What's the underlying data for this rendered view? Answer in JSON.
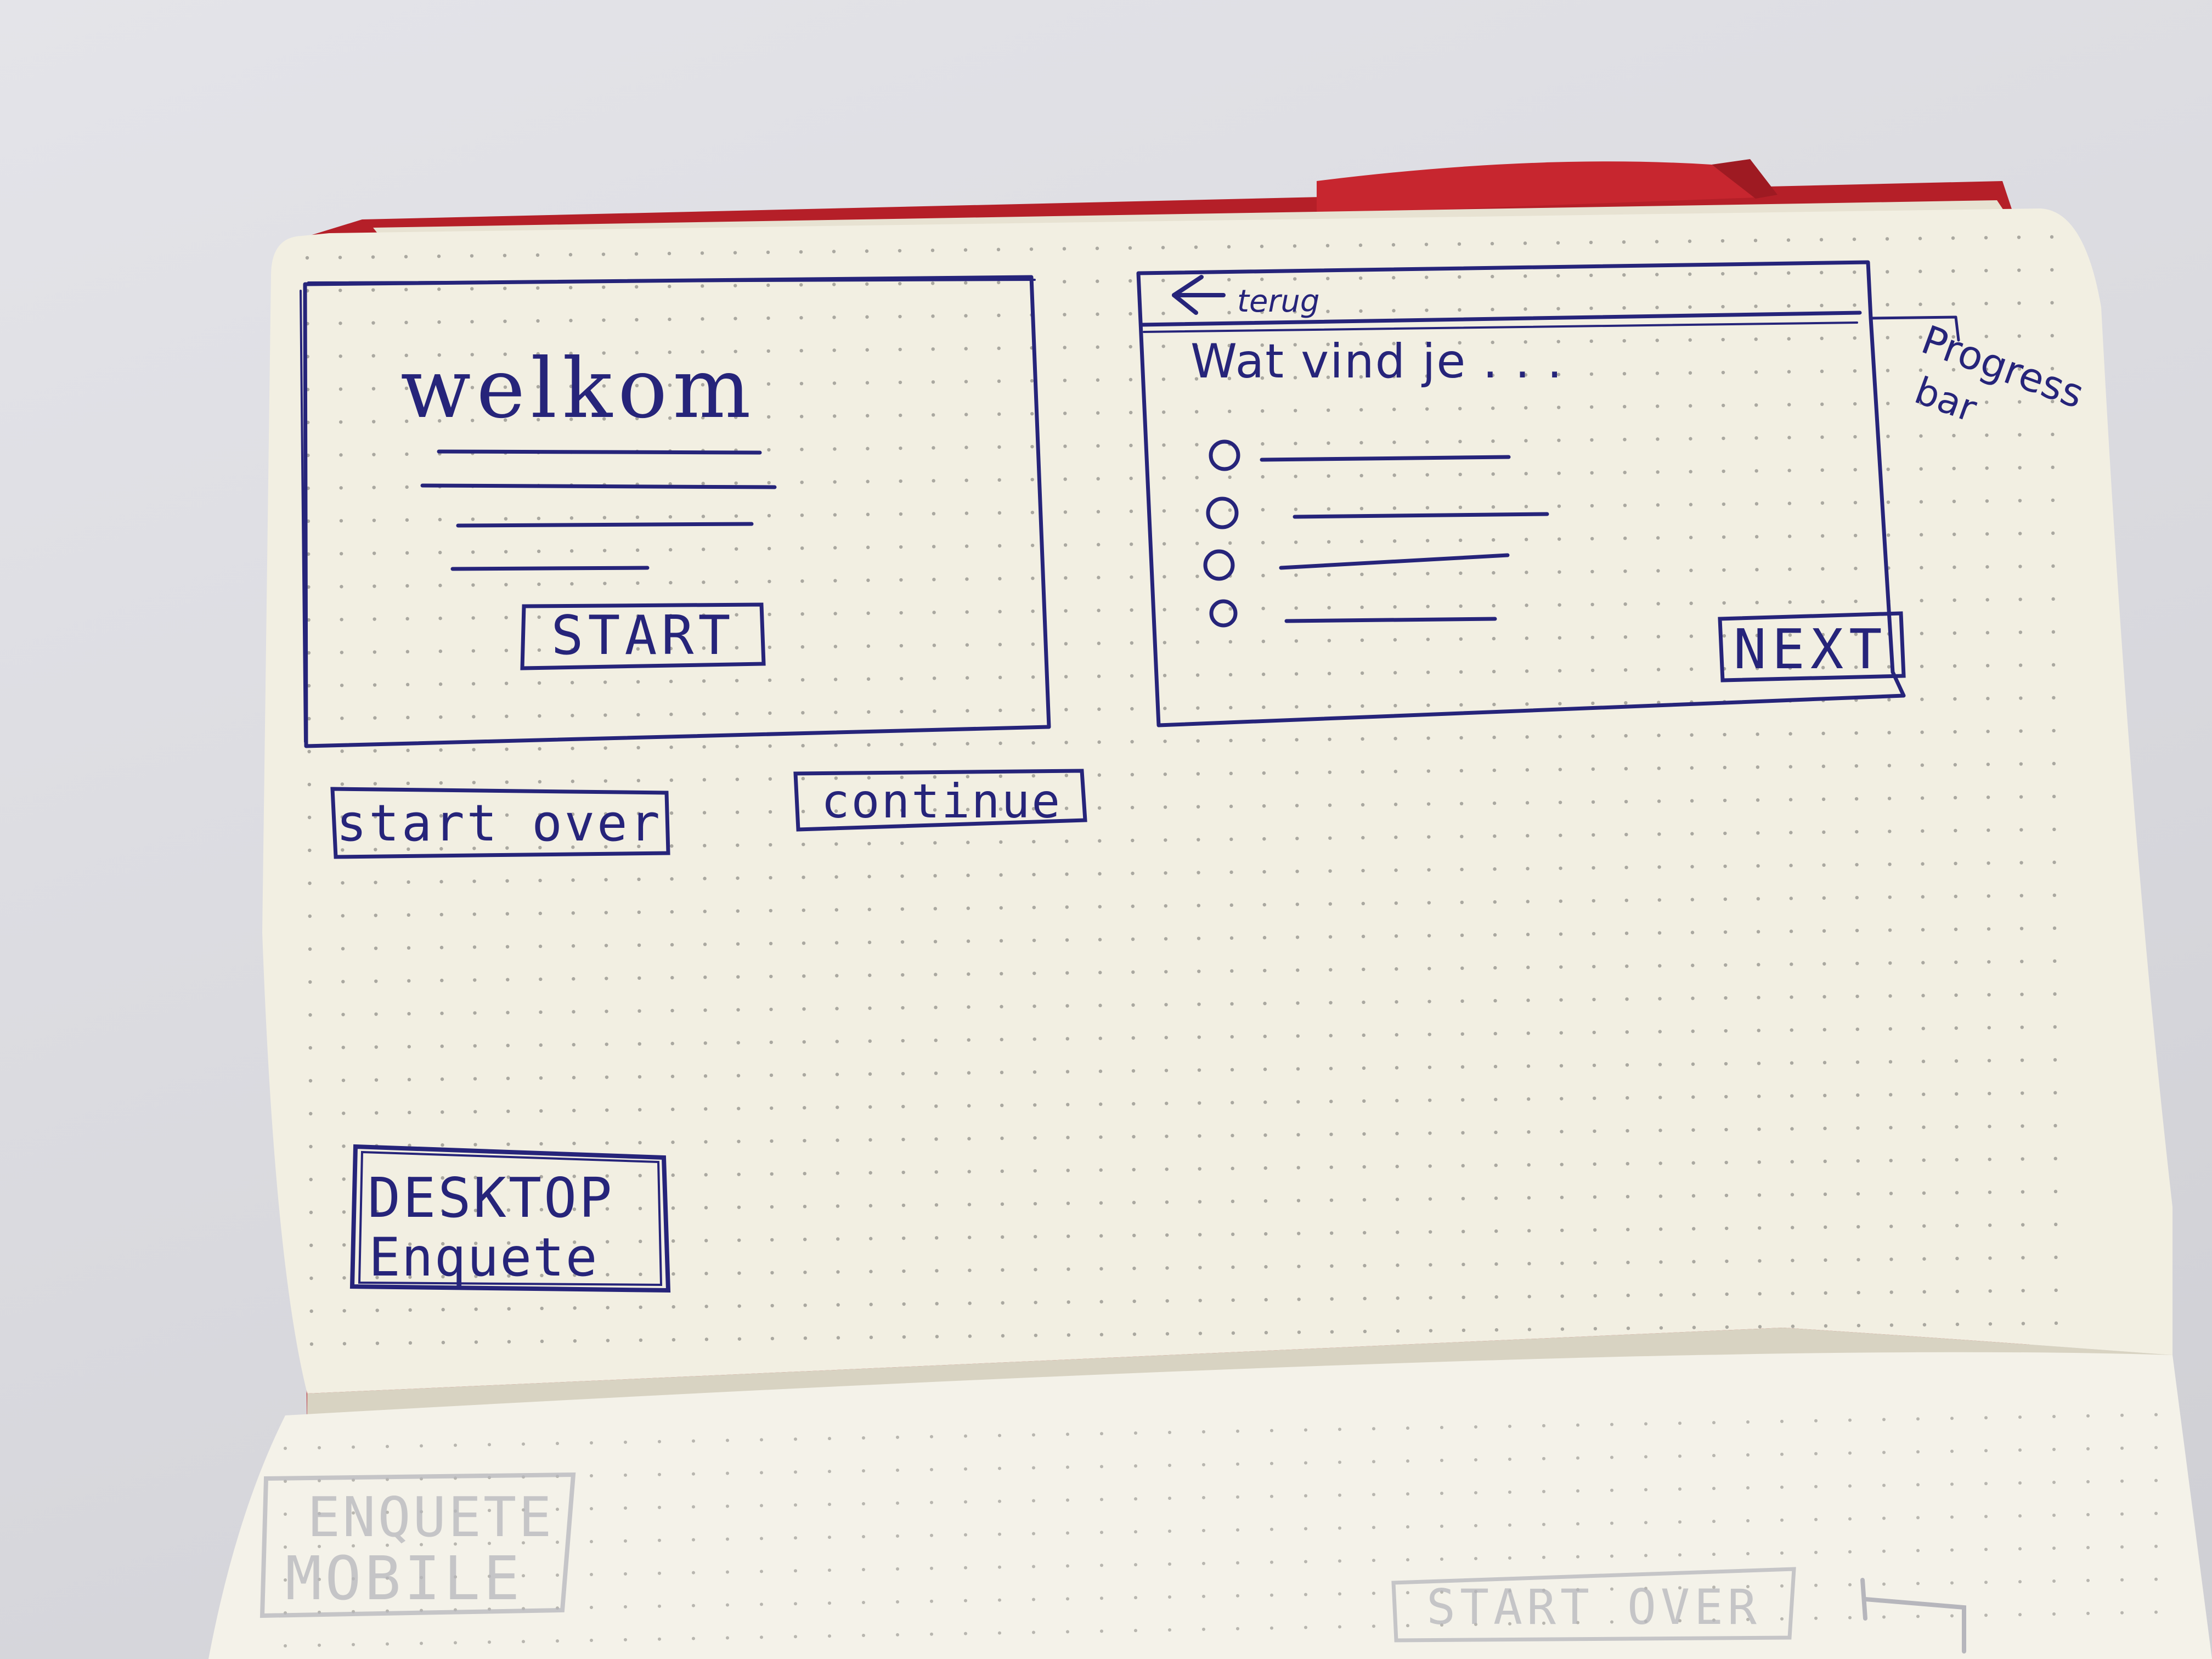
{
  "colors": {
    "ink": "#26247a",
    "paper": "#f2efe2",
    "cover": "#c0232b",
    "background": "#dcdce1"
  },
  "welcome_screen": {
    "title": "welkom",
    "start_button": "START"
  },
  "side_buttons": {
    "start_over": "start over",
    "continue": "continue"
  },
  "question_screen": {
    "back_icon": "arrow-left-icon",
    "back_label": "terug",
    "question": "Wat vind je . . .",
    "options_count": 4,
    "next_button": "NEXT"
  },
  "annotation": {
    "line1": "Progress",
    "line2": "bar"
  },
  "page_label": {
    "line1": "DESKTOP",
    "line2": "Enquete"
  },
  "next_page_ghost": {
    "label_line1": "ENQUETE",
    "label_line2": "MOBILE",
    "label_right": "START OVER"
  }
}
